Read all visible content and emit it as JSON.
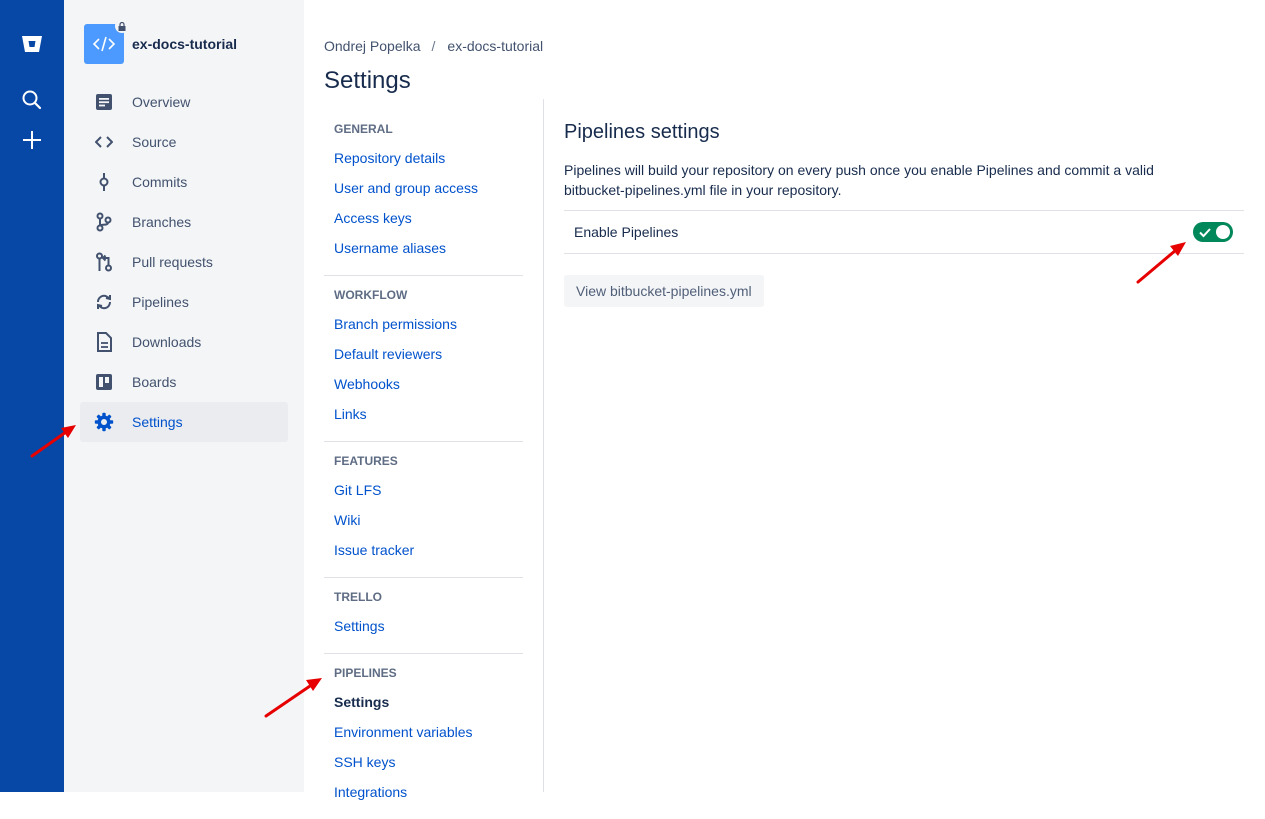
{
  "repo": {
    "name": "ex-docs-tutorial"
  },
  "sidebar": {
    "items": [
      {
        "label": "Overview",
        "icon": "overview-icon"
      },
      {
        "label": "Source",
        "icon": "source-code-icon"
      },
      {
        "label": "Commits",
        "icon": "commit-icon"
      },
      {
        "label": "Branches",
        "icon": "branch-icon"
      },
      {
        "label": "Pull requests",
        "icon": "pull-request-icon"
      },
      {
        "label": "Pipelines",
        "icon": "pipelines-icon"
      },
      {
        "label": "Downloads",
        "icon": "download-file-icon"
      },
      {
        "label": "Boards",
        "icon": "board-icon"
      },
      {
        "label": "Settings",
        "icon": "gear-icon",
        "active": true
      }
    ]
  },
  "breadcrumb": {
    "owner": "Ondrej Popelka",
    "separator": "/",
    "repo": "ex-docs-tutorial"
  },
  "page": {
    "title": "Settings"
  },
  "settings_nav": {
    "general": {
      "heading": "GENERAL",
      "links": [
        "Repository details",
        "User and group access",
        "Access keys",
        "Username aliases"
      ]
    },
    "workflow": {
      "heading": "WORKFLOW",
      "links": [
        "Branch permissions",
        "Default reviewers",
        "Webhooks",
        "Links"
      ]
    },
    "features": {
      "heading": "FEATURES",
      "links": [
        "Git LFS",
        "Wiki",
        "Issue tracker"
      ]
    },
    "trello": {
      "heading": "TRELLO",
      "links": [
        "Settings"
      ]
    },
    "pipelines": {
      "heading": "PIPELINES",
      "links": [
        "Settings",
        "Environment variables",
        "SSH keys",
        "Integrations"
      ],
      "current": "Settings"
    }
  },
  "content": {
    "title": "Pipelines settings",
    "description": "Pipelines will build your repository on every push once you enable Pipelines and commit a valid bitbucket-pipelines.yml file in your repository.",
    "enable_label": "Enable Pipelines",
    "enable_state": true,
    "view_button": "View bitbucket-pipelines.yml"
  },
  "colors": {
    "global_nav": "#0747a6",
    "link": "#0052cc",
    "toggle_on": "#00875a",
    "annotation_arrow": "#e60000"
  }
}
